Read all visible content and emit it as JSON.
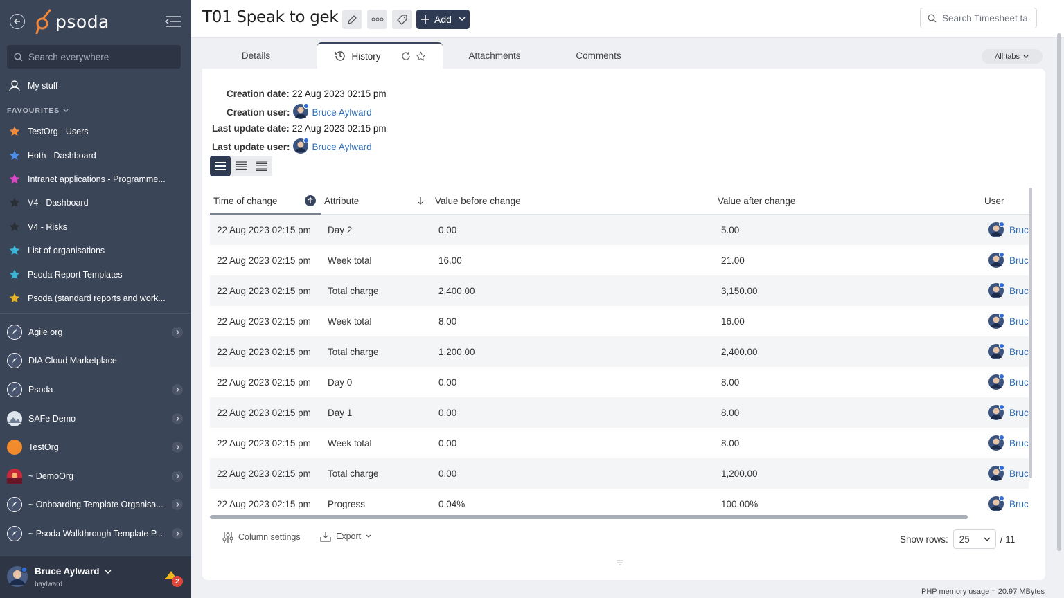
{
  "sidebar": {
    "logo_text": "psoda",
    "search_placeholder": "Search everywhere",
    "my_stuff": "My stuff",
    "favourites_heading": "FAVOURITES",
    "favourites": [
      {
        "label": "TestOrg - Users",
        "color": "#f08a3c"
      },
      {
        "label": "Hoth - Dashboard",
        "color": "#4c8ee8"
      },
      {
        "label": "Intranet applications - Programme...",
        "color": "#d946c2"
      },
      {
        "label": "V4 - Dashboard",
        "color": "#2b2f36"
      },
      {
        "label": "V4 - Risks",
        "color": "#2b2f36"
      },
      {
        "label": "List of organisations",
        "color": "#3bb6d8"
      },
      {
        "label": "Psoda Report Templates",
        "color": "#3bb6d8"
      },
      {
        "label": "Psoda (standard reports and work...",
        "color": "#e6b422"
      }
    ],
    "orgs": [
      {
        "label": "Agile org",
        "chevron": true,
        "icon": "compass"
      },
      {
        "label": "DIA Cloud Marketplace",
        "chevron": false,
        "icon": "compass"
      },
      {
        "label": "Psoda",
        "chevron": true,
        "icon": "compass"
      },
      {
        "label": "SAFe Demo",
        "chevron": true,
        "icon": "mountain"
      },
      {
        "label": "TestOrg",
        "chevron": true,
        "icon": "orange"
      },
      {
        "label": "~ DemoOrg",
        "chevron": true,
        "icon": "sunset"
      },
      {
        "label": "~ Onboarding Template Organisa...",
        "chevron": true,
        "icon": "compass"
      },
      {
        "label": "~ Psoda Walkthrough Template P...",
        "chevron": true,
        "icon": "compass"
      }
    ],
    "user": {
      "name": "Bruce Aylward",
      "username": "baylward",
      "notifications": "2"
    }
  },
  "header": {
    "title": "T01 Speak to gek",
    "add_label": "Add",
    "search_placeholder": "Search Timesheet ta"
  },
  "tabs": [
    {
      "label": "Details",
      "active": false
    },
    {
      "label": "History",
      "active": true
    },
    {
      "label": "Attachments",
      "active": false
    },
    {
      "label": "Comments",
      "active": false
    }
  ],
  "all_tabs_label": "All tabs",
  "meta": {
    "creation_date_label": "Creation date:",
    "creation_date": "22 Aug 2023 02:15 pm",
    "creation_user_label": "Creation user:",
    "creation_user": "Bruce Aylward",
    "last_update_date_label": "Last update date:",
    "last_update_date": "22 Aug 2023 02:15 pm",
    "last_update_user_label": "Last update user:",
    "last_update_user": "Bruce Aylward"
  },
  "table": {
    "columns": [
      "Time of change",
      "Attribute",
      "Value before change",
      "Value after change",
      "User"
    ],
    "rows": [
      {
        "time": "22 Aug 2023 02:15 pm",
        "attribute": "Day 2",
        "before": "0.00",
        "after": "5.00",
        "user": "Bruce Aylward"
      },
      {
        "time": "22 Aug 2023 02:15 pm",
        "attribute": "Week total",
        "before": "16.00",
        "after": "21.00",
        "user": "Bruce Aylward"
      },
      {
        "time": "22 Aug 2023 02:15 pm",
        "attribute": "Total charge",
        "before": "2,400.00",
        "after": "3,150.00",
        "user": "Bruce Aylward"
      },
      {
        "time": "22 Aug 2023 02:15 pm",
        "attribute": "Week total",
        "before": "8.00",
        "after": "16.00",
        "user": "Bruce Aylward"
      },
      {
        "time": "22 Aug 2023 02:15 pm",
        "attribute": "Total charge",
        "before": "1,200.00",
        "after": "2,400.00",
        "user": "Bruce Aylward"
      },
      {
        "time": "22 Aug 2023 02:15 pm",
        "attribute": "Day 0",
        "before": "0.00",
        "after": "8.00",
        "user": "Bruce Aylward"
      },
      {
        "time": "22 Aug 2023 02:15 pm",
        "attribute": "Day 1",
        "before": "0.00",
        "after": "8.00",
        "user": "Bruce Aylward"
      },
      {
        "time": "22 Aug 2023 02:15 pm",
        "attribute": "Week total",
        "before": "0.00",
        "after": "8.00",
        "user": "Bruce Aylward"
      },
      {
        "time": "22 Aug 2023 02:15 pm",
        "attribute": "Total charge",
        "before": "0.00",
        "after": "1,200.00",
        "user": "Bruce Aylward"
      },
      {
        "time": "22 Aug 2023 02:15 pm",
        "attribute": "Progress",
        "before": "0.04%",
        "after": "100.00%",
        "user": "Bruce Aylward"
      }
    ],
    "column_settings_label": "Column settings",
    "export_label": "Export",
    "show_rows_label": "Show rows:",
    "rows_per_page": "25",
    "total_pages": "/ 11"
  },
  "memory_usage": "PHP memory usage = 20.97 MBytes"
}
